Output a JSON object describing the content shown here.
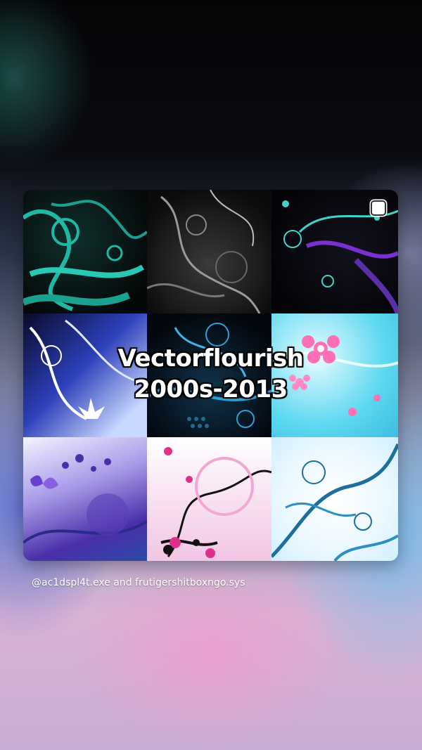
{
  "title": {
    "line1": "Vectorflourish",
    "line2": "2000s-2013"
  },
  "credit": "@ac1dspl4t.exe and frutigershitboxngo.sys",
  "tiles": [
    {
      "name": "tile-teal-swirls",
      "palette": [
        "#1fb8a4",
        "#0e2f2c"
      ]
    },
    {
      "name": "tile-grey-swirls",
      "palette": [
        "#bdbdbd",
        "#0b0b0b"
      ]
    },
    {
      "name": "tile-neon-purple-swirls",
      "palette": [
        "#3fd4c8",
        "#7a2fd0"
      ]
    },
    {
      "name": "tile-blue-flower-swirls",
      "palette": [
        "#2b3fb8",
        "#ffffff"
      ]
    },
    {
      "name": "tile-dark-blue-halftone",
      "palette": [
        "#2f9fd8",
        "#03060c"
      ]
    },
    {
      "name": "tile-cyan-pink-flowers",
      "palette": [
        "#5ed8f0",
        "#ff6fb5"
      ]
    },
    {
      "name": "tile-purple-butterfly",
      "palette": [
        "#4a2fa8",
        "#a89ae8"
      ]
    },
    {
      "name": "tile-pink-black-flowers",
      "palette": [
        "#e0308c",
        "#111111"
      ]
    },
    {
      "name": "tile-blue-white-swirls",
      "palette": [
        "#1b6f9a",
        "#ffffff"
      ]
    }
  ],
  "colors": {
    "title_text": "#ffffff",
    "title_outline": "#000000"
  },
  "icons": {
    "corner_button": "select-square-icon"
  }
}
